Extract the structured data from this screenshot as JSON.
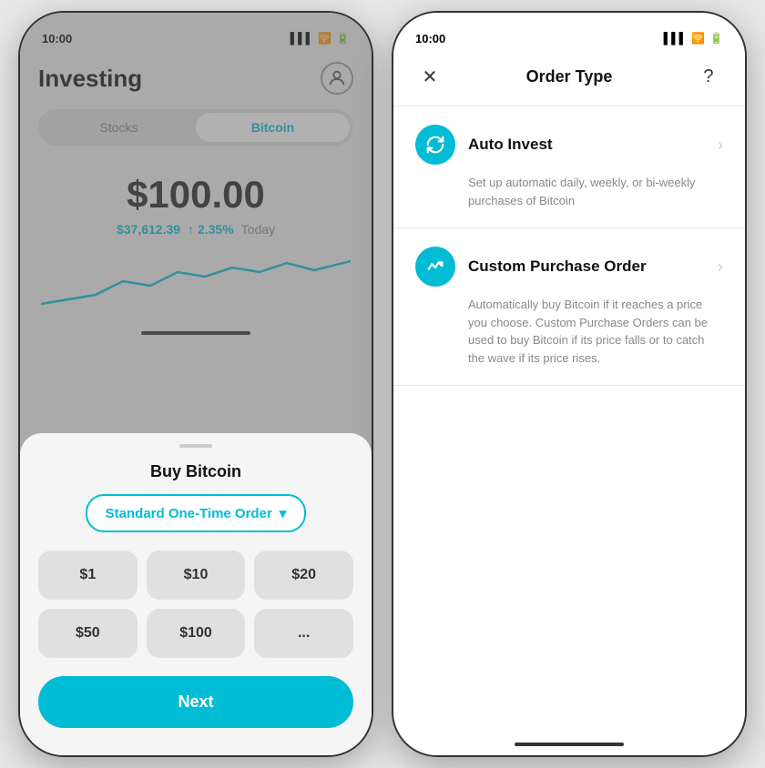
{
  "left_phone": {
    "status_time": "10:00",
    "title": "Investing",
    "tabs": [
      "Stocks",
      "Bitcoin"
    ],
    "active_tab": "Bitcoin",
    "price_main": "$100.00",
    "price_btc": "$37,612.39",
    "price_arrow": "↑",
    "price_change": "2.35%",
    "price_today": "Today",
    "sheet": {
      "title": "Buy Bitcoin",
      "order_type_label": "Standard One-Time Order",
      "order_type_chevron": "▾",
      "amounts": [
        "$1",
        "$10",
        "$20",
        "$50",
        "$100",
        "..."
      ],
      "next_label": "Next"
    }
  },
  "right_phone": {
    "status_time": "10:00",
    "header": {
      "close_label": "✕",
      "title": "Order Type",
      "help_label": "?"
    },
    "items": [
      {
        "id": "auto-invest",
        "name": "Auto Invest",
        "icon": "↻",
        "description": "Set up automatic daily, weekly, or bi-weekly purchases of Bitcoin"
      },
      {
        "id": "custom-purchase",
        "name": "Custom Purchase Order",
        "icon": "↗",
        "description": "Automatically buy Bitcoin if it reaches a price you choose. Custom Purchase Orders can be used to buy Bitcoin if its price falls or to catch the wave if its price rises."
      }
    ]
  }
}
